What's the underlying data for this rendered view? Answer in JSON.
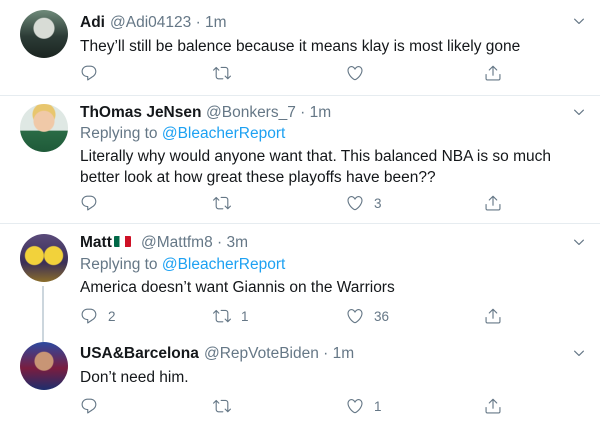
{
  "tweets": [
    {
      "name": "Adi",
      "handle": "@Adi04123",
      "time": "1m",
      "replying_prefix": "",
      "replying_to": "",
      "text": "They’ll still be balence because it means klay is most likely gone",
      "reply_count": "",
      "retweet_count": "",
      "like_count": ""
    },
    {
      "name": "ThOmas JeNsen",
      "handle": "@Bonkers_7",
      "time": "1m",
      "replying_prefix": "Replying to",
      "replying_to": "@BleacherReport",
      "text": "Literally why would anyone want that. This balanced NBA is so much better look at how great these playoffs have been??",
      "reply_count": "",
      "retweet_count": "",
      "like_count": "3"
    },
    {
      "name": "Matt",
      "handle": "@Mattfm8",
      "time": "3m",
      "replying_prefix": "Replying to",
      "replying_to": "@BleacherReport",
      "text": "America doesn’t want Giannis on the Warriors",
      "reply_count": "2",
      "retweet_count": "1",
      "like_count": "36"
    },
    {
      "name": "USA&Barcelona",
      "handle": "@RepVoteBiden",
      "time": "1m",
      "replying_prefix": "",
      "replying_to": "",
      "text": "Don’t need him.",
      "reply_count": "",
      "retweet_count": "",
      "like_count": "1"
    }
  ],
  "separator": "·",
  "icons": {
    "reply": "reply-icon",
    "retweet": "retweet-icon",
    "like": "heart-icon",
    "share": "share-icon",
    "menu": "chevron-down-icon"
  },
  "colors": {
    "link": "#1da1f2",
    "secondary_text": "#657786",
    "divider": "#e6ecf0"
  }
}
